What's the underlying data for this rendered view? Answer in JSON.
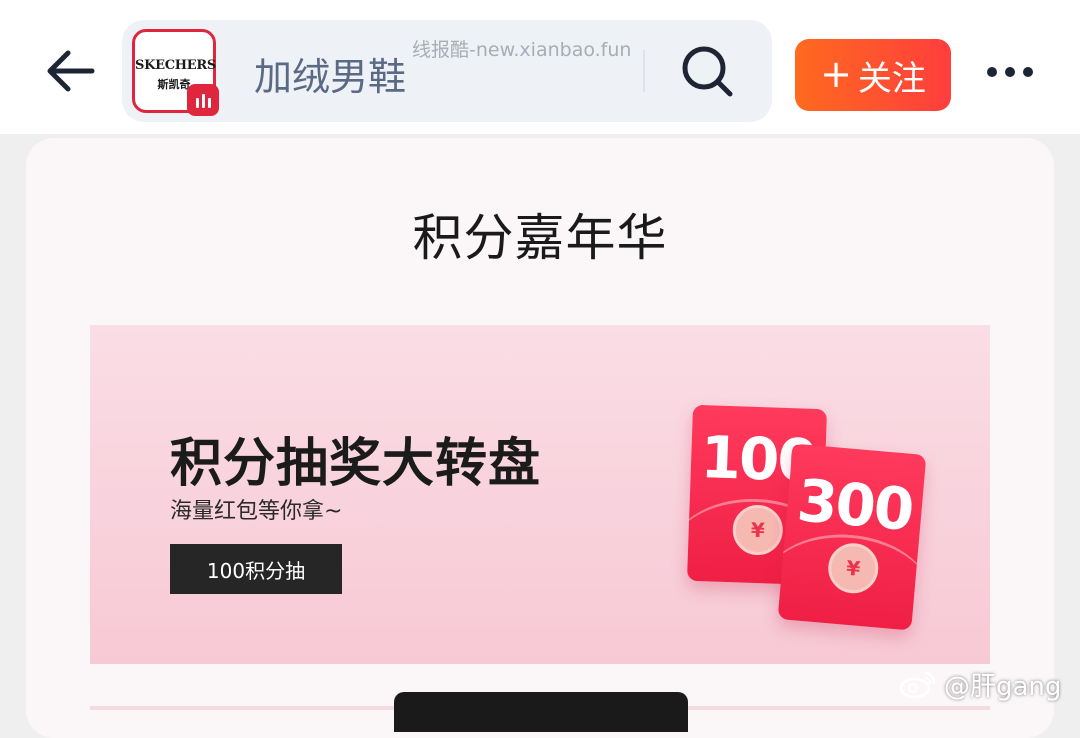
{
  "topbar": {
    "search_query": "加绒男鞋",
    "watermark": "线报酷-new.xianbao.fun",
    "follow_label": "关注",
    "follow_plus": "+",
    "logo": {
      "brand": "SKECHERS",
      "brand_cn": "斯凯奇"
    }
  },
  "main": {
    "section_title": "积分嘉年华",
    "banner": {
      "title": "积分抽奖大转盘",
      "subtitle": "海量红包等你拿~",
      "button_label": "100积分抽",
      "envelopes": [
        {
          "amount": "100",
          "symbol": "¥"
        },
        {
          "amount": "300",
          "symbol": "¥"
        }
      ]
    }
  },
  "overlay": {
    "weibo_mark": "@肝gang"
  },
  "colors": {
    "accent_orange": "#ff6a1f",
    "accent_red": "#ff3d3d",
    "brand_red": "#e0263c",
    "banner_pink": "#f7c9d5",
    "dark_button": "#262626"
  },
  "icons": [
    "back-arrow-icon",
    "search-icon",
    "more-dots-icon",
    "store-badge-icon",
    "weibo-icon"
  ]
}
